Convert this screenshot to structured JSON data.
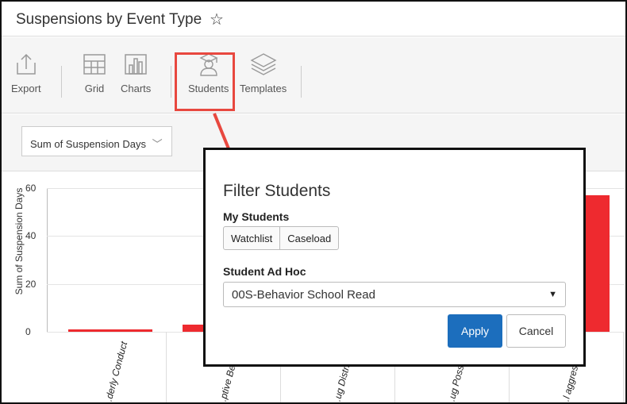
{
  "page": {
    "title": "Suspensions by Event Type",
    "favorite_icon": "star-outline-icon"
  },
  "toolbar": {
    "items": [
      {
        "label": "Export",
        "icon": "export-icon"
      },
      {
        "label": "Grid",
        "icon": "grid-icon"
      },
      {
        "label": "Charts",
        "icon": "bar-chart-icon"
      },
      {
        "label": "Students",
        "icon": "student-icon"
      },
      {
        "label": "Templates",
        "icon": "layers-icon"
      }
    ]
  },
  "filter": {
    "measure_select": "Sum of Suspension Days"
  },
  "colors": {
    "bar": "#ee2a2f",
    "highlight": "#e8483f",
    "primary_button": "#1c6ebd"
  },
  "chart_data": {
    "type": "bar",
    "ylabel": "Sum of Suspension Days",
    "ylim": [
      0,
      60
    ],
    "yticks": [
      "60",
      "40",
      "20",
      "0"
    ],
    "categories": [
      "...derly Conduct",
      "...ptive Be...",
      "...ug Distri...",
      "...ug Posse...",
      "...l aggression..."
    ],
    "values": [
      1,
      3,
      null,
      null,
      57
    ]
  },
  "modal": {
    "title": "Filter Students",
    "my_students_label": "My Students",
    "watchlist_label": "Watchlist",
    "caseload_label": "Caseload",
    "ad_hoc_label": "Student Ad Hoc",
    "ad_hoc_value": "00S-Behavior School Read",
    "apply_label": "Apply",
    "cancel_label": "Cancel"
  }
}
